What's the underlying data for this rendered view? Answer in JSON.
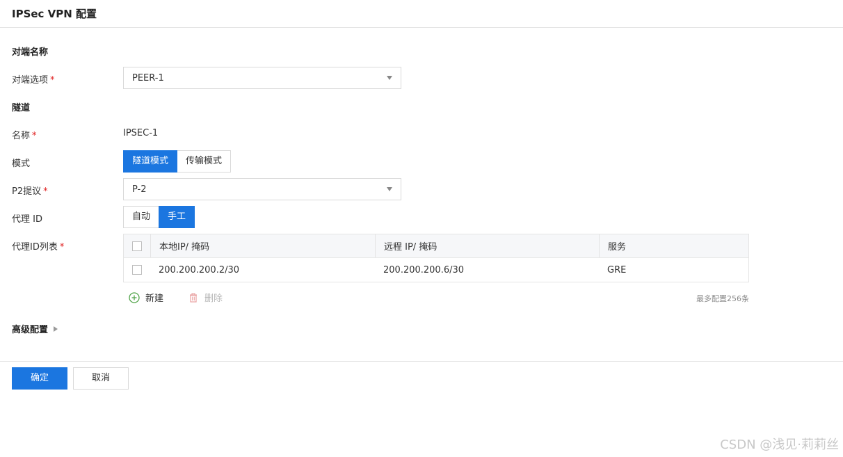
{
  "header": {
    "title": "IPSec VPN 配置"
  },
  "peer_section": {
    "title": "对端名称",
    "peer_option": {
      "label": "对端选项",
      "required_mark": "*",
      "value": "PEER-1"
    }
  },
  "tunnel_section": {
    "title": "隧道",
    "name": {
      "label": "名称",
      "required_mark": "*",
      "value": "IPSEC-1"
    },
    "mode": {
      "label": "模式",
      "options": [
        "隧道模式",
        "传输模式"
      ],
      "selected": "隧道模式"
    },
    "p2_proposal": {
      "label": "P2提议",
      "required_mark": "*",
      "value": "P-2"
    },
    "proxy_id": {
      "label": "代理 ID",
      "options": [
        "自动",
        "手工"
      ],
      "selected": "手工"
    },
    "proxy_id_list": {
      "label": "代理ID列表",
      "required_mark": "*",
      "columns": [
        "本地IP/ 掩码",
        "远程 IP/ 掩码",
        "服务"
      ],
      "rows": [
        {
          "checked": false,
          "local": "200.200.200.2/30",
          "remote": "200.200.200.6/30",
          "service": "GRE"
        }
      ],
      "header_checked": false,
      "actions": {
        "add": "新建",
        "delete": "删除"
      },
      "limit_note": "最多配置256条"
    }
  },
  "advanced": {
    "label": "高级配置",
    "expanded": false
  },
  "footer": {
    "confirm": "确定",
    "cancel": "取消"
  },
  "watermark": "CSDN @浅见·莉莉丝",
  "colors": {
    "primary": "#1b76e0",
    "required": "#e02020",
    "disabled": "#b8b8b8",
    "add_icon": "#52a44a"
  }
}
